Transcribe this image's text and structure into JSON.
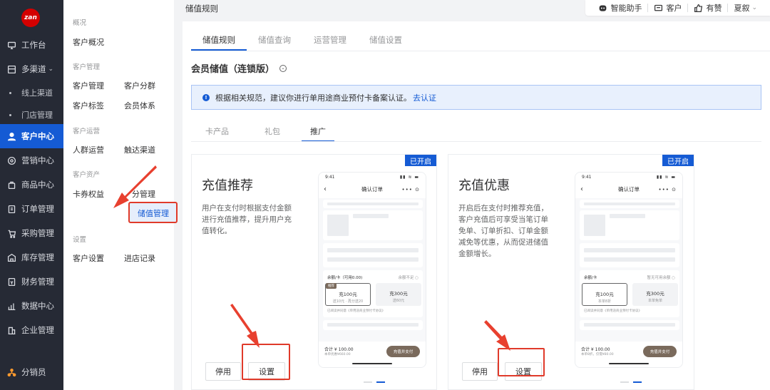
{
  "nav": {
    "logo": "zan",
    "items": [
      {
        "label": "工作台",
        "icon": "monitor-icon"
      },
      {
        "label": "多渠道",
        "icon": "channel-icon",
        "chevron": "⌄"
      },
      {
        "label": "线上渠道",
        "sub": true
      },
      {
        "label": "门店管理",
        "sub": true
      },
      {
        "label": "客户中心",
        "icon": "user-icon",
        "active": true
      },
      {
        "label": "营销中心",
        "icon": "marketing-icon"
      },
      {
        "label": "商品中心",
        "icon": "bag-icon"
      },
      {
        "label": "订单管理",
        "icon": "order-icon"
      },
      {
        "label": "采购管理",
        "icon": "cart-icon"
      },
      {
        "label": "库存管理",
        "icon": "warehouse-icon"
      },
      {
        "label": "财务管理",
        "icon": "finance-icon"
      },
      {
        "label": "数据中心",
        "icon": "chart-icon"
      },
      {
        "label": "企业管理",
        "icon": "building-icon"
      },
      {
        "label": "分销员",
        "icon": "distributor-icon"
      }
    ]
  },
  "submenu": {
    "g1": "概况",
    "overview": "客户概况",
    "g2": "客户管理",
    "manage": "客户管理",
    "segment": "客户分群",
    "tags": "客户标签",
    "member": "会员体系",
    "g3": "客户运营",
    "crowd": "人群运营",
    "reach": "触达渠道",
    "g4": "客户资产",
    "coupon": "卡券权益",
    "points": "分管理",
    "stored": "储值管理",
    "g5": "设置",
    "settings": "客户设置",
    "visits": "进店记录"
  },
  "header": {
    "page_title": "储值规则",
    "assistant": "智能助手",
    "customer": "客户",
    "like": "有赞",
    "user": "夏叙",
    "user_chevron": "⌄"
  },
  "tabs": [
    "储值规则",
    "储值查询",
    "运营管理",
    "储值设置"
  ],
  "section": {
    "title": "会员储值（连锁版）",
    "chevron": "⌄"
  },
  "notice": {
    "icon": "!",
    "text": "根据相关规范，建议你进行单用途商业预付卡备案认证。",
    "link": "去认证"
  },
  "content_tabs": [
    "卡产品",
    "礼包",
    "推广"
  ],
  "cards": [
    {
      "badge": "已开启",
      "title": "充值推荐",
      "desc": "用户在支付时根据支付金额进行充值推荐，提升用户充值转化。",
      "stop": "停用",
      "set": "设置",
      "phone": {
        "time": "9:41",
        "signal": "▮▮ ≋ ▬",
        "title": "确认订单",
        "back": "‹",
        "more": "••• ⊙",
        "balance": "余额/卡（可用0.00)",
        "insufficient": "余额不足 ○",
        "tag": "推荐",
        "o1_amt": "充100元",
        "o1_sub": "送10元 · 再分送20",
        "o2_amt": "充300元",
        "o2_sub": "送60元",
        "note": "已阅读并同意《单用途商业预付卡协议》",
        "price": "合计 ¥ 100.00",
        "price_sub": "本单优惠¥660.00",
        "pay": "充值并支付"
      }
    },
    {
      "badge": "已开启",
      "title": "充值优惠",
      "desc": "开启后在支付时推荐充值，客户充值后可享受当笔订单免单、订单折扣、订单金额减免等优惠，从而促进储值金额增长。",
      "stop": "停用",
      "set": "设置",
      "phone": {
        "time": "9:41",
        "signal": "▮▮ ≋ ▬",
        "title": "确认订单",
        "back": "‹",
        "more": "••• ⊙",
        "balance": "余额/卡",
        "insufficient": "暂无可用余额 ○",
        "o1_amt": "充100元",
        "o1_sub": "本单8折",
        "o2_amt": "充300元",
        "o2_sub": "本单免单",
        "note": "已阅读并同意《单用途商业预付卡协议》",
        "price": "合计 ¥ 100.00",
        "price_sub": "本单8折，仅需¥80.00",
        "pay": "充值并支付"
      }
    }
  ],
  "colors": {
    "accent": "#155bd4",
    "sidebar": "#262a35",
    "highlight": "#e03a2a"
  }
}
